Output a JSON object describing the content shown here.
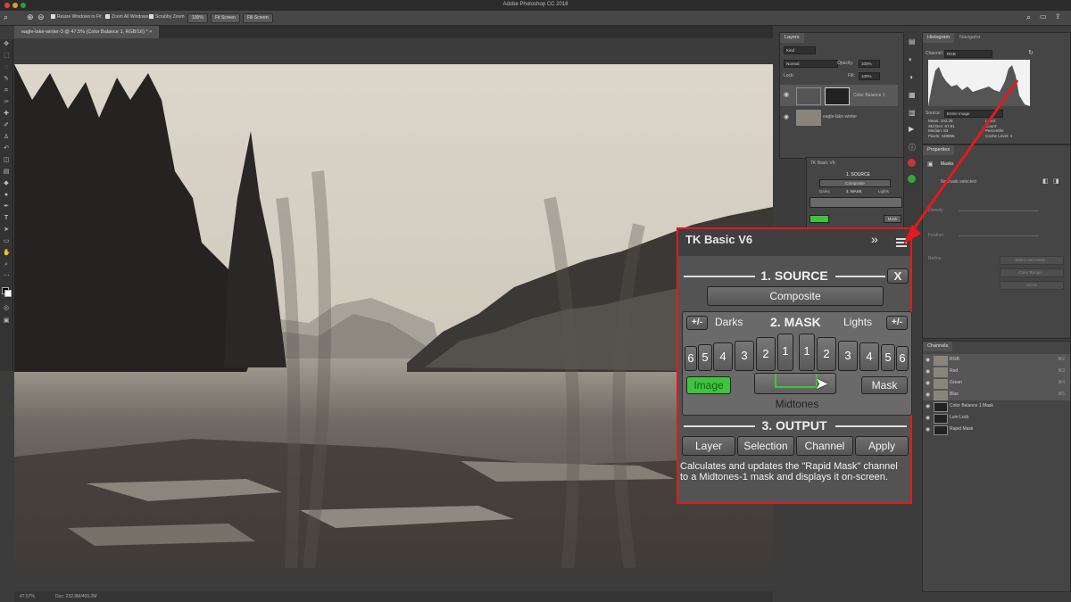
{
  "app_title": "Adobe Photoshop CC 2018",
  "options_bar": {
    "resize_windows": "Resize Windows to Fit",
    "zoom_all": "Zoom All Windows",
    "scrubby_zoom": "Scrubby Zoom",
    "zoom_pct": "100%",
    "fit_screen": "Fit Screen",
    "fill_screen": "Fill Screen"
  },
  "document_tab": "eagle-lake-winter-3 @ 47.5% (Color Balance 1, RGB/16) *",
  "status": {
    "zoom": "47.57%",
    "doc": "Doc: 232.9M/409.2M"
  },
  "layers_panel": {
    "tab": "Layers",
    "kind": "Kind",
    "mode": "Normal",
    "opacity_label": "Opacity:",
    "opacity": "100%",
    "lock_label": "Lock:",
    "fill_label": "Fill:",
    "fill": "100%",
    "layers": [
      {
        "name": "Color Balance 1"
      },
      {
        "name": "eagle-lake-winter"
      }
    ]
  },
  "histogram_panel": {
    "tabs": [
      "Histogram",
      "Navigator"
    ],
    "channel_label": "Channel:",
    "channel": "RGB",
    "source_label": "Source:",
    "source": "Entire Image",
    "stats": [
      {
        "label": "Mean:",
        "value": "102.29"
      },
      {
        "label": "Std Dev:",
        "value": "67.91"
      },
      {
        "label": "Median:",
        "value": "83"
      },
      {
        "label": "Pixels:",
        "value": "349855"
      }
    ],
    "stats_right": [
      {
        "label": "Level:",
        "value": ""
      },
      {
        "label": "Count:",
        "value": ""
      },
      {
        "label": "Percentile:",
        "value": ""
      },
      {
        "label": "Cache Level:",
        "value": "4"
      }
    ]
  },
  "properties_panel": {
    "tab": "Properties",
    "title": "Masks",
    "no_mask": "No mask selected",
    "density": "Density:",
    "feather": "Feather:",
    "refine": "Refine:",
    "select_mask": "Select and Mask...",
    "color_range": "Color Range...",
    "invert": "Invert"
  },
  "channels_panel": {
    "tab": "Channels",
    "channels": [
      {
        "name": "RGB",
        "shortcut": "⌘2"
      },
      {
        "name": "Red",
        "shortcut": "⌘3"
      },
      {
        "name": "Green",
        "shortcut": "⌘4"
      },
      {
        "name": "Blue",
        "shortcut": "⌘5"
      },
      {
        "name": "Color Balance 1 Mask",
        "shortcut": ""
      },
      {
        "name": "Lum Lock",
        "shortcut": ""
      },
      {
        "name": "Rapid Mask",
        "shortcut": ""
      }
    ]
  },
  "tk_panel": {
    "title": "TK Basic V6",
    "expand": "»",
    "source_header": "1. SOURCE",
    "close": "X",
    "composite": "Composite",
    "mask_header": "2. MASK",
    "darks": "Darks",
    "lights": "Lights",
    "plus_minus": "+/-",
    "darks_keys": [
      "6",
      "5",
      "4",
      "3",
      "2",
      "1"
    ],
    "lights_keys": [
      "1",
      "2",
      "3",
      "4",
      "5",
      "6"
    ],
    "image_btn": "Image",
    "mask_btn": "Mask",
    "midtones": "Midtones",
    "output_header": "3. OUTPUT",
    "output_buttons": [
      "Layer",
      "Selection",
      "Channel",
      "Apply"
    ],
    "description": "Calculates and updates the \"Rapid Mask\" channel to a Midtones-1 mask and displays it on-screen."
  },
  "tk_small": {
    "title": "TK Basic V6",
    "source_header": "1. SOURCE",
    "composite": "Composite",
    "darks": "Darks",
    "mask_header": "2. MASK",
    "lights": "Lights",
    "mask_btn": "Mask"
  },
  "colors": {
    "highlight": "#e21a1a",
    "image_green": "#3ec43e",
    "canvas_sky": "#d6d0c4"
  }
}
